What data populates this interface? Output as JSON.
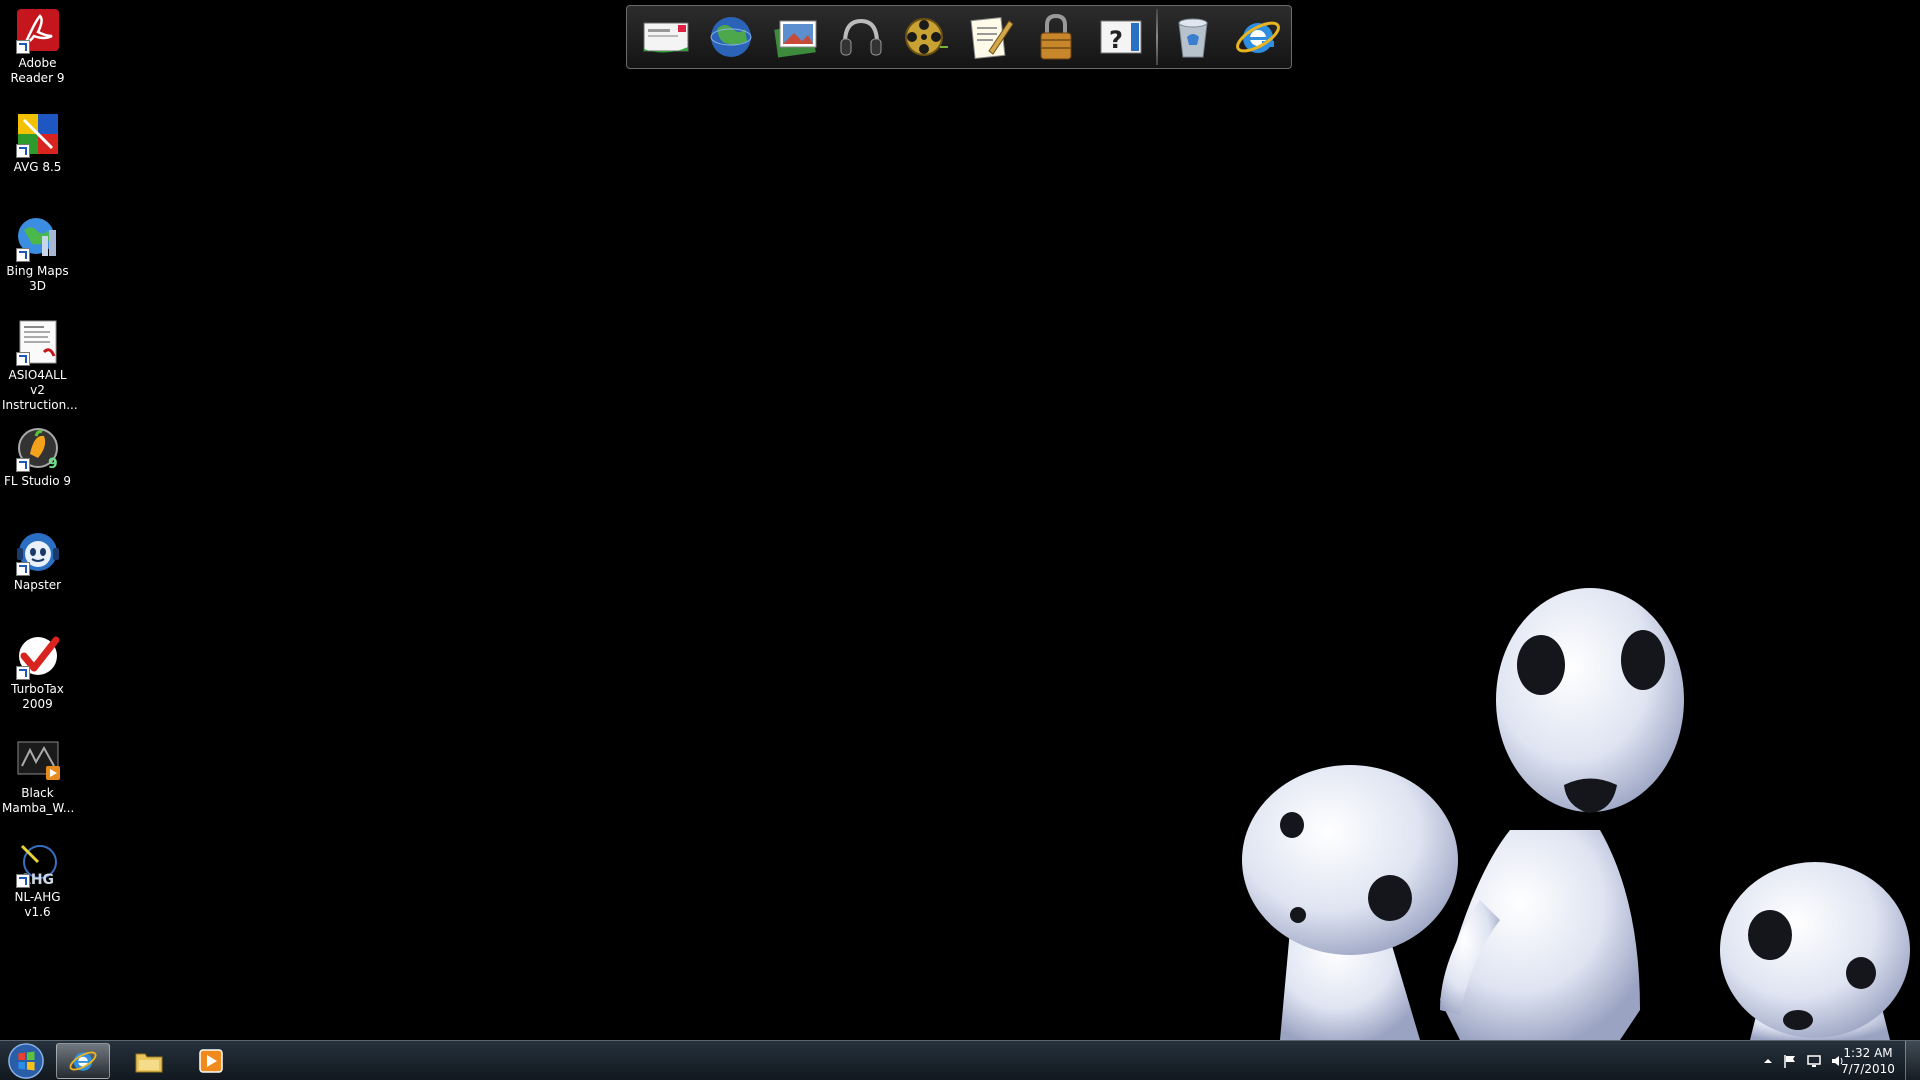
{
  "desktop": {
    "icons": [
      {
        "label": "Adobe Reader 9",
        "icon": "adobe-reader-icon"
      },
      {
        "label": "AVG 8.5",
        "icon": "avg-icon"
      },
      {
        "label": "Bing Maps 3D",
        "icon": "bing-maps-icon"
      },
      {
        "label": "ASIO4ALL v2 Instruction...",
        "icon": "pdf-document-icon"
      },
      {
        "label": "FL Studio 9",
        "icon": "fl-studio-icon"
      },
      {
        "label": "Napster",
        "icon": "napster-icon"
      },
      {
        "label": "TurboTax 2009",
        "icon": "turbotax-icon"
      },
      {
        "label": "Black Mamba_W...",
        "icon": "video-file-icon"
      },
      {
        "label": "NL-AHG v1.6",
        "icon": "ahg-app-icon"
      }
    ]
  },
  "dock": {
    "items": [
      "mail-icon",
      "globe-icon",
      "photos-icon",
      "headphones-icon",
      "film-reel-icon",
      "notepad-icon",
      "padlock-icon",
      "help-icon",
      "recycle-bin-icon",
      "internet-explorer-icon"
    ]
  },
  "taskbar": {
    "start": "windows-start-icon",
    "pinned": [
      "internet-explorer-icon",
      "file-explorer-icon",
      "media-player-icon"
    ],
    "tray_icons": [
      "show-hidden-icons-icon",
      "action-center-flag-icon",
      "network-icon",
      "volume-icon"
    ],
    "clock": {
      "time": "1:32 AM",
      "date": "7/7/2010"
    }
  },
  "colors": {
    "background": "#000000",
    "spirit": "#e8ecf6",
    "taskbar": "#2a3a4a"
  }
}
